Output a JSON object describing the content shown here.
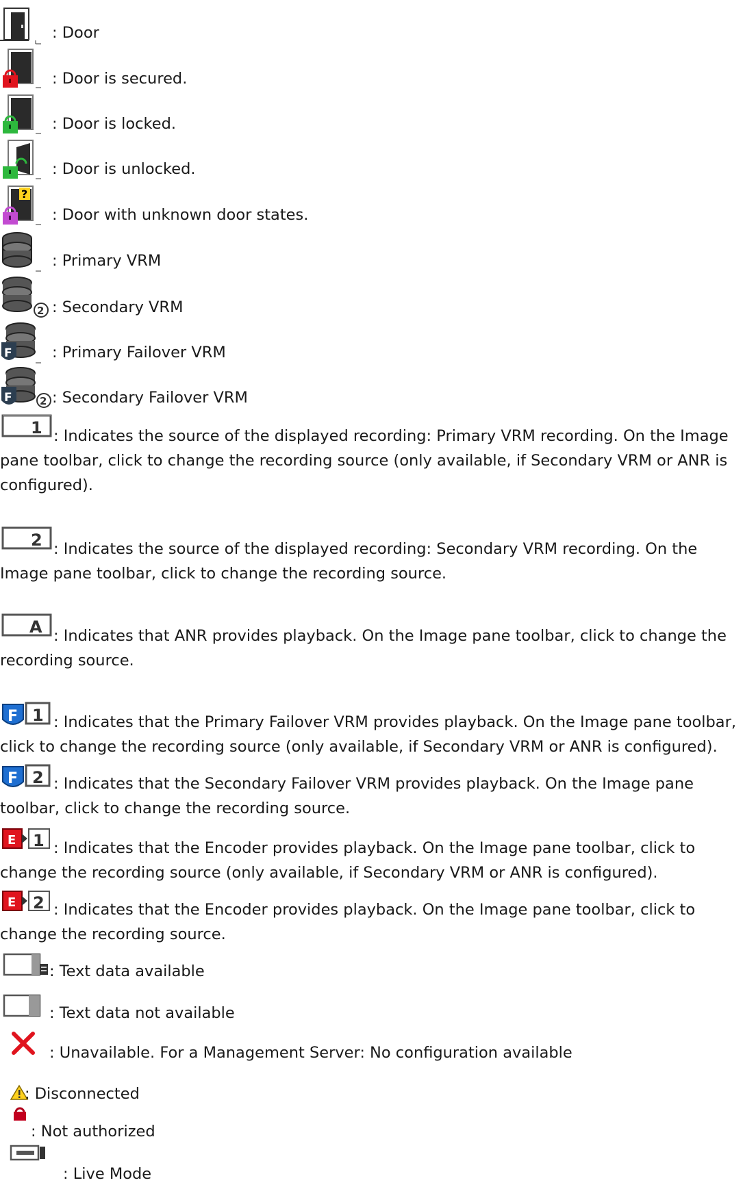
{
  "colors": {
    "lock_red": "#e0141e",
    "lock_green": "#2db83d",
    "lock_magenta": "#c24bd1",
    "failover_blue": "#1f6fd1",
    "encoder_red": "#e0141e",
    "unavailable_red": "#e0141e",
    "warning_yellow": "#ffd21e"
  },
  "items": [
    {
      "icon": "door-icon",
      "text": ": Door"
    },
    {
      "icon": "door-secured-icon",
      "text": ": Door is secured."
    },
    {
      "icon": "door-locked-icon",
      "text": ": Door is locked."
    },
    {
      "icon": "door-unlocked-icon",
      "text": ": Door is unlocked."
    },
    {
      "icon": "door-unknown-state-icon",
      "text": ": Door with unknown door states."
    },
    {
      "icon": "primary-vrm-icon",
      "text": ": Primary VRM"
    },
    {
      "icon": "secondary-vrm-icon",
      "text": ": Secondary VRM"
    },
    {
      "icon": "primary-failover-vrm-icon",
      "text": ": Primary Failover VRM"
    },
    {
      "icon": "secondary-failover-vrm-icon",
      "text": ": Secondary Failover VRM"
    },
    {
      "icon": "recording-source-1-icon",
      "text": ": Indicates the source of the displayed recording: Primary VRM recording. On the Image pane toolbar, click to change the recording source (only available, if Secondary VRM or ANR is configured)."
    },
    {
      "icon": "recording-source-2-icon",
      "text": ": Indicates the source of the displayed recording: Secondary VRM recording. On the Image pane toolbar, click to change the recording source."
    },
    {
      "icon": "recording-source-anr-icon",
      "text": ": Indicates that ANR provides playback. On the Image pane toolbar, click to change the recording source."
    },
    {
      "icon": "failover-1-icon",
      "text": ": Indicates that the Primary Failover VRM provides playback. On the Image pane toolbar, click to change the recording source (only available, if Secondary VRM or ANR is configured)."
    },
    {
      "icon": "failover-2-icon",
      "text": ": Indicates that the Secondary Failover VRM provides playback. On the Image pane toolbar, click to change the recording source."
    },
    {
      "icon": "encoder-1-icon",
      "text": ": Indicates that the Encoder provides playback. On the Image pane toolbar, click to change the recording source (only available, if Secondary VRM or ANR is configured)."
    },
    {
      "icon": "encoder-2-icon",
      "text": ": Indicates that the Encoder provides playback. On the Image pane toolbar, click to change the recording source."
    },
    {
      "icon": "text-data-available-icon",
      "text": ": Text data available"
    },
    {
      "icon": "text-data-not-available-icon",
      "text": ": Text data not available"
    },
    {
      "icon": "unavailable-icon",
      "text": ": Unavailable. For a Management Server: No configuration available"
    },
    {
      "icon": "disconnected-warning-icon",
      "text": ": Disconnected"
    },
    {
      "icon": "not-authorized-lock-icon",
      "text": ": Not authorized"
    },
    {
      "icon": "live-mode-icon",
      "text": ": Live Mode"
    }
  ]
}
